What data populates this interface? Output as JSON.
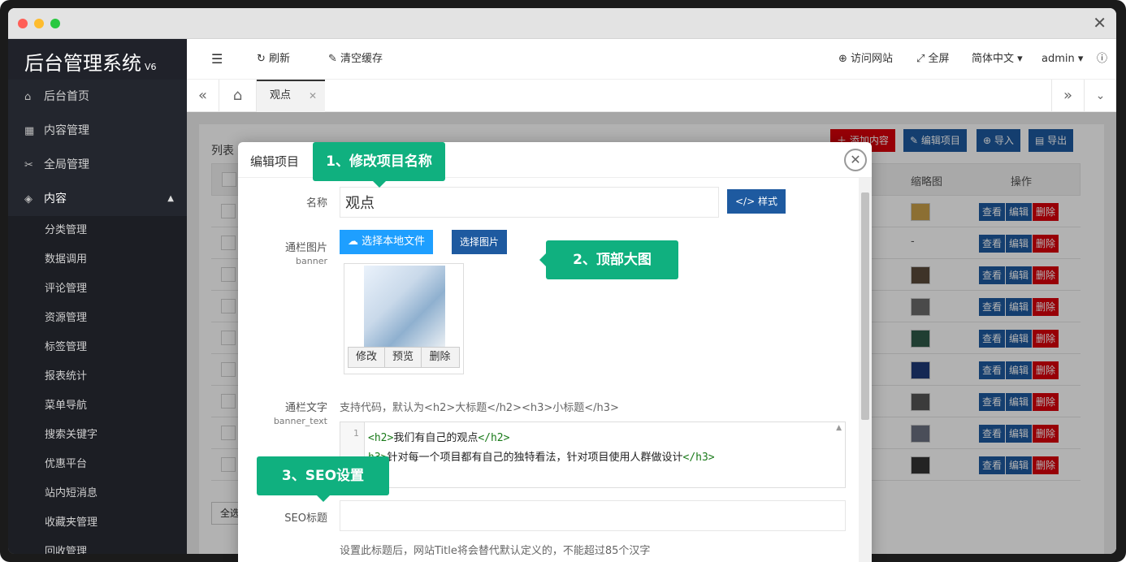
{
  "app": {
    "title": "后台管理系统",
    "version": "V6"
  },
  "sidebar": {
    "items": [
      {
        "label": "后台首页",
        "icon": "home-icon"
      },
      {
        "label": "内容管理",
        "icon": "grid-icon"
      },
      {
        "label": "全局管理",
        "icon": "tools-icon"
      },
      {
        "label": "内容",
        "icon": "cube-icon"
      }
    ],
    "sub_items": [
      "分类管理",
      "数据调用",
      "评论管理",
      "资源管理",
      "标签管理",
      "报表统计",
      "菜单导航",
      "搜索关键字",
      "优惠平台",
      "站内短消息",
      "收藏夹管理",
      "回收管理"
    ]
  },
  "topbar": {
    "refresh": "刷新",
    "clear_cache": "清空缓存",
    "visit_site": "访问网站",
    "fullscreen": "全屏",
    "language": "简体中文",
    "user": "admin"
  },
  "tabs": {
    "active": "观点"
  },
  "list": {
    "title": "列表",
    "add": "添加内容",
    "edit_project": "编辑项目",
    "import": "导入",
    "export": "导出",
    "col_thumb": "缩略图",
    "col_ops": "操作",
    "view": "查看",
    "edit": "编辑",
    "delete": "删除",
    "select_all": "全选",
    "dash": "-"
  },
  "modal": {
    "title": "编辑项目",
    "name_label": "名称",
    "name_value": "观点",
    "style_btn": "样式",
    "banner_label": "通栏图片",
    "banner_en": "banner",
    "upload_local": "选择本地文件",
    "choose_image": "选择图片",
    "img_modify": "修改",
    "img_preview": "预览",
    "img_delete": "删除",
    "banner_text_label": "通栏文字",
    "banner_text_en": "banner_text",
    "banner_text_hint": "支持代码，默认为<h2>大标题</h2><h3>小标题</h3>",
    "code_line_no": "1",
    "code_line1_open": "<h2>",
    "code_line1_text": "我们有自己的观点",
    "code_line1_close": "</h2>",
    "code_line2_open": "h3>",
    "code_line2_text": "针对每一个项目都有自己的独特看法，针对项目使用人群做设计",
    "code_line2_close": "</h3>",
    "seo_title_label": "SEO标题",
    "seo_hint": "设置此标题后，网站Title将会替代默认定义的，不能超过85个汉字"
  },
  "callouts": {
    "c1": "1、修改项目名称",
    "c2": "2、顶部大图",
    "c3": "3、SEO设置"
  },
  "colors": {
    "sidebar": "#23262e",
    "primary": "#1e5aa0",
    "danger": "#d9000b",
    "callout": "#10b07f",
    "upload": "#1e9fff"
  }
}
